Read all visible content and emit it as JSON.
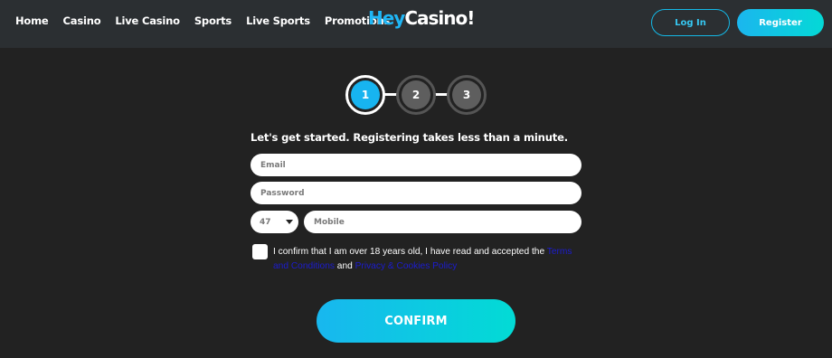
{
  "nav": {
    "items": [
      {
        "label": "Home"
      },
      {
        "label": "Casino"
      },
      {
        "label": "Live Casino"
      },
      {
        "label": "Sports"
      },
      {
        "label": "Live Sports"
      },
      {
        "label": "Promotions"
      }
    ]
  },
  "logo": {
    "part1": "Hey",
    "part2": "Casino!"
  },
  "header": {
    "login_label": "Log In",
    "register_label": "Register"
  },
  "steps": {
    "labels": [
      "1",
      "2",
      "3"
    ],
    "active": 1
  },
  "form": {
    "intro": "Let's get started. Registering takes less than a minute.",
    "email_placeholder": "Email",
    "password_placeholder": "Password",
    "country_code": "47",
    "mobile_placeholder": "Mobile",
    "terms_prefix": "I confirm that I am over 18 years old, I have read and accepted the ",
    "terms_link": "Terms and Conditions",
    "terms_and": " and ",
    "privacy_link": "Privacy & Cookies Policy",
    "confirm_label": "CONFIRM",
    "terms_checked": false
  },
  "colors": {
    "background": "#222222",
    "header": "#2b2f32",
    "accent_blue": "#17b4f0",
    "accent_teal": "#02dbd5",
    "link": "#1c1cd0"
  }
}
